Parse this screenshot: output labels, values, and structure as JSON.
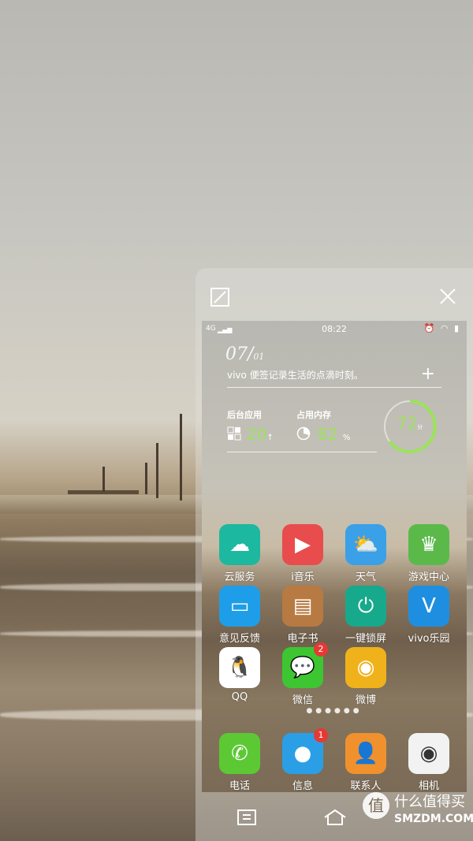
{
  "panel": {
    "expand_icon": "expand-icon",
    "close_icon": "close-icon"
  },
  "status_bar": {
    "network": "4G",
    "time": "08:22",
    "icons": [
      "alarm-icon",
      "wifi-icon",
      "battery-icon"
    ]
  },
  "memo": {
    "date_day": "07",
    "date_month": "01",
    "text": "vivo 便签记录生活的点滴时刻。"
  },
  "stats": {
    "background_apps_label": "后台应用",
    "background_apps_value": "20",
    "memory_label": "占用内存",
    "memory_value": "82",
    "memory_unit": "%",
    "score": "72",
    "score_unit": "分"
  },
  "apps": [
    {
      "label": "云服务",
      "icon": "cloud-icon",
      "color": "#1cb8a0"
    },
    {
      "label": "i音乐",
      "icon": "play-icon",
      "color": "#e84c4c"
    },
    {
      "label": "天气",
      "icon": "weather-icon",
      "color": "#3aa0e8"
    },
    {
      "label": "游戏中心",
      "icon": "crown-icon",
      "color": "#5bb94a"
    },
    {
      "label": "意见反馈",
      "icon": "feedback-icon",
      "color": "#1e9ee8"
    },
    {
      "label": "电子书",
      "icon": "book-icon",
      "color": "#b77a42"
    },
    {
      "label": "一键锁屏",
      "icon": "lock-icon",
      "color": "#17a98c"
    },
    {
      "label": "vivo乐园",
      "icon": "vivo-icon",
      "color": "#1e8fe0"
    },
    {
      "label": "QQ",
      "icon": "qq-icon",
      "color": "#ffffff"
    },
    {
      "label": "微信",
      "icon": "wechat-icon",
      "color": "#3dc631",
      "badge": "2"
    },
    {
      "label": "微博",
      "icon": "weibo-icon",
      "color": "#f0b21b"
    }
  ],
  "dock": [
    {
      "label": "电话",
      "icon": "phone-icon",
      "color": "#5cc934"
    },
    {
      "label": "信息",
      "icon": "message-icon",
      "color": "#2a9fe6",
      "badge": "1"
    },
    {
      "label": "联系人",
      "icon": "contacts-icon",
      "color": "#f0912e"
    },
    {
      "label": "相机",
      "icon": "camera-icon",
      "color": "#f2f2f2"
    }
  ],
  "navbar": {
    "menu_icon": "menu-icon",
    "home_icon": "home-icon"
  },
  "watermark": {
    "logo_char": "值",
    "line1": "什么值得买",
    "line2": "SMZDM.COM"
  }
}
